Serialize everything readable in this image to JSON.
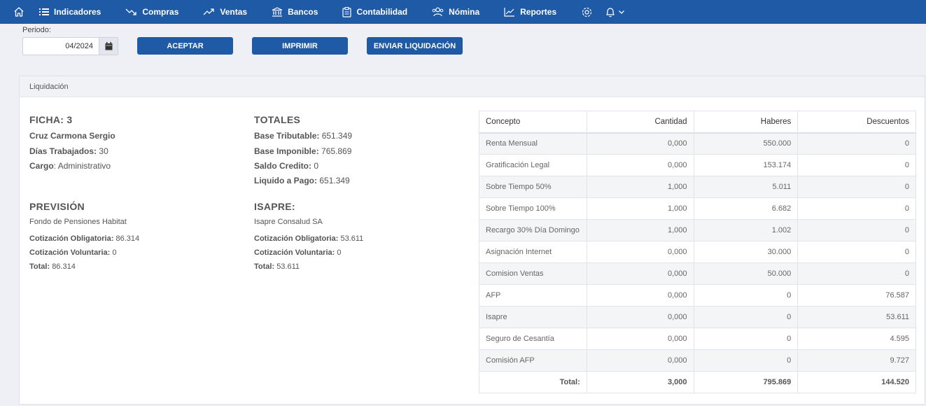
{
  "nav": {
    "items": [
      {
        "label": "Indicadores",
        "icon": "list-icon"
      },
      {
        "label": "Compras",
        "icon": "trend-down-icon"
      },
      {
        "label": "Ventas",
        "icon": "trend-up-icon"
      },
      {
        "label": "Bancos",
        "icon": "bank-icon"
      },
      {
        "label": "Contabilidad",
        "icon": "clipboard-icon"
      },
      {
        "label": "Nómina",
        "icon": "users-icon"
      },
      {
        "label": "Reportes",
        "icon": "chart-icon"
      }
    ]
  },
  "period": {
    "label": "Periodo:",
    "value": "04/2024"
  },
  "buttons": {
    "accept": "ACEPTAR",
    "print": "IMPRIMIR",
    "send": "ENVIAR LIQUIDACIÓN"
  },
  "card": {
    "title": "Liquidación"
  },
  "ficha": {
    "title": "FICHA: 3",
    "name": "Cruz Carmona Sergio",
    "dias_label": "Días Trabajados:",
    "dias_value": "30",
    "cargo_label": "Cargo",
    "cargo_value": "Administrativo"
  },
  "totales": {
    "title": "TOTALES",
    "base_trib_label": "Base Tributable:",
    "base_trib_value": "651.349",
    "base_imp_label": "Base Imponible:",
    "base_imp_value": "765.869",
    "saldo_label": "Saldo Credito:",
    "saldo_value": "0",
    "liquido_label": "Liquido a Pago:",
    "liquido_value": "651.349"
  },
  "prevision": {
    "title": "PREVISIÓN",
    "entity": "Fondo de Pensiones Habitat",
    "oblig_label": "Cotización Obligatoria:",
    "oblig_value": "86.314",
    "vol_label": "Cotización Voluntaria:",
    "vol_value": "0",
    "total_label": "Total:",
    "total_value": "86.314"
  },
  "isapre": {
    "title": "ISAPRE:",
    "entity": "Isapre Consalud SA",
    "oblig_label": "Cotización Obligatoria:",
    "oblig_value": "53.611",
    "vol_label": "Cotización Voluntaria:",
    "vol_value": "0",
    "total_label": "Total:",
    "total_value": "53.611"
  },
  "table": {
    "headers": [
      "Concepto",
      "Cantidad",
      "Haberes",
      "Descuentos"
    ],
    "rows": [
      [
        "Renta Mensual",
        "0,000",
        "550.000",
        "0"
      ],
      [
        "Gratificación Legal",
        "0,000",
        "153.174",
        "0"
      ],
      [
        "Sobre Tiempo 50%",
        "1,000",
        "5.011",
        "0"
      ],
      [
        "Sobre Tiempo 100%",
        "1,000",
        "6.682",
        "0"
      ],
      [
        "Recargo 30% Día Domingo",
        "1,000",
        "1.002",
        "0"
      ],
      [
        "Asignación Internet",
        "0,000",
        "30.000",
        "0"
      ],
      [
        "Comision Ventas",
        "0,000",
        "50.000",
        "0"
      ],
      [
        "AFP",
        "0,000",
        "0",
        "76.587"
      ],
      [
        "Isapre",
        "0,000",
        "0",
        "53.611"
      ],
      [
        "Seguro de Cesantía",
        "0,000",
        "0",
        "4.595"
      ],
      [
        "Comisión AFP",
        "0,000",
        "0",
        "9.727"
      ]
    ],
    "total": [
      "Total:",
      "3,000",
      "795.869",
      "144.520"
    ]
  }
}
